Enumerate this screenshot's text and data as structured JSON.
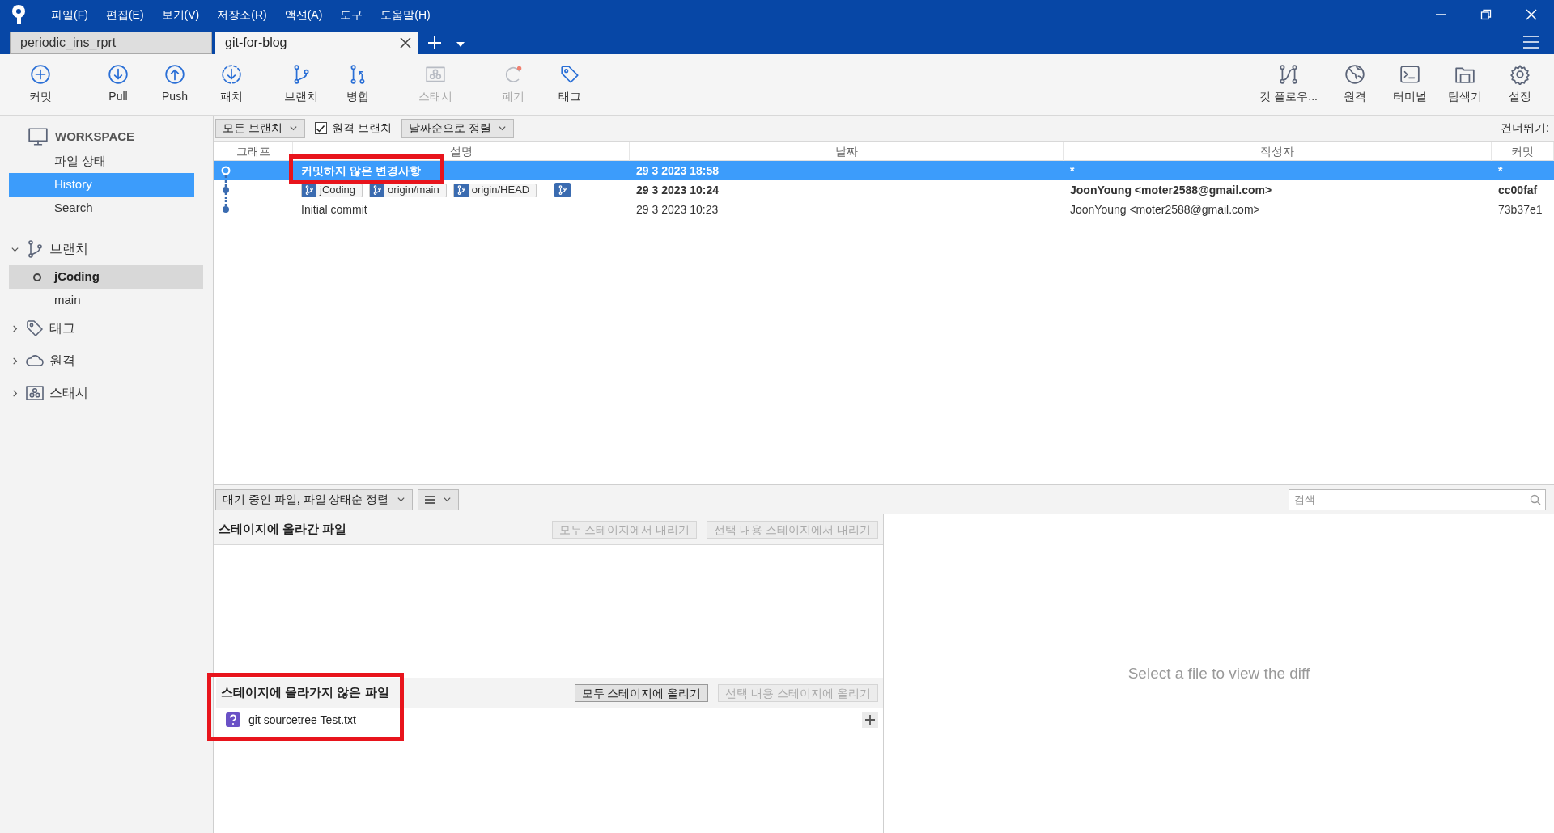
{
  "menu": [
    "파일(F)",
    "편집(E)",
    "보기(V)",
    "저장소(R)",
    "액션(A)",
    "도구",
    "도움말(H)"
  ],
  "tabs": [
    {
      "label": "periodic_ins_rprt",
      "selected": false
    },
    {
      "label": "git-for-blog",
      "selected": true
    }
  ],
  "toolbar_left": [
    {
      "label": "커밋",
      "disabled": false
    },
    {
      "label": "Pull",
      "disabled": false
    },
    {
      "label": "Push",
      "disabled": false
    },
    {
      "label": "패치",
      "disabled": false
    },
    {
      "label": "브랜치",
      "disabled": false
    },
    {
      "label": "병합",
      "disabled": false
    },
    {
      "label": "스태시",
      "disabled": true
    },
    {
      "label": "폐기",
      "disabled": true
    },
    {
      "label": "태그",
      "disabled": false
    }
  ],
  "toolbar_right": [
    {
      "label": "깃 플로우..."
    },
    {
      "label": "원격"
    },
    {
      "label": "터미널"
    },
    {
      "label": "탐색기"
    },
    {
      "label": "설정"
    }
  ],
  "sidebar": {
    "workspace": "WORKSPACE",
    "workspace_items": [
      {
        "label": "파일 상태",
        "selected": false
      },
      {
        "label": "History",
        "selected": true
      },
      {
        "label": "Search",
        "selected": false
      }
    ],
    "sections": [
      {
        "label": "브랜치",
        "expanded": true,
        "children": [
          {
            "label": "jCoding",
            "current": true,
            "selected": true
          },
          {
            "label": "main",
            "current": false,
            "selected": false
          }
        ]
      },
      {
        "label": "태그",
        "expanded": false
      },
      {
        "label": "원격",
        "expanded": false
      },
      {
        "label": "스태시",
        "expanded": false
      }
    ]
  },
  "filter_bar": {
    "branches": "모든 브랜치",
    "remote_branches": {
      "label": "원격 브랜치",
      "checked": true
    },
    "sort": "날짜순으로 정렬",
    "jump": "건너뛰기:"
  },
  "table": {
    "columns": [
      "그래프",
      "설명",
      "날짜",
      "작성자",
      "커밋"
    ],
    "rows": [
      {
        "kind": "uncommitted",
        "selected": true,
        "bold": true,
        "description": "커밋하지 않은 변경사항",
        "date": "29 3 2023 18:58",
        "author": "*",
        "commit": "*"
      },
      {
        "kind": "commit",
        "selected": false,
        "bold": true,
        "tags": [
          {
            "kind": "label",
            "label": "jCoding"
          },
          {
            "kind": "label",
            "label": "origin/main"
          },
          {
            "kind": "label",
            "label": "origin/HEAD"
          },
          {
            "kind": "icon"
          }
        ],
        "date": "29 3 2023 10:24",
        "author": "JoonYoung <moter2588@gmail.com>",
        "commit": "cc00faf"
      },
      {
        "kind": "commit",
        "selected": false,
        "bold": false,
        "description": "Initial commit",
        "date": "29 3 2023 10:23",
        "author": "JoonYoung <moter2588@gmail.com>",
        "commit": "73b37e1"
      }
    ]
  },
  "bottom_bar": {
    "sort": "대기 중인 파일, 파일 상태순 정렬",
    "search": {
      "placeholder": "검색"
    }
  },
  "staged": {
    "title": "스테이지에 올라간 파일",
    "buttons": [
      {
        "label": "모두 스테이지에서 내리기",
        "disabled": true
      },
      {
        "label": "선택 내용 스테이지에서 내리기",
        "disabled": true
      }
    ]
  },
  "unstaged": {
    "title": "스테이지에 올라가지 않은 파일",
    "buttons": [
      {
        "label": "모두 스테이지에 올리기",
        "disabled": false
      },
      {
        "label": "선택 내용 스테이지에 올리기",
        "disabled": true
      }
    ],
    "files": [
      {
        "name": "git sourcetree Test.txt"
      }
    ]
  },
  "diff": {
    "message": "Select a file to view the diff"
  }
}
